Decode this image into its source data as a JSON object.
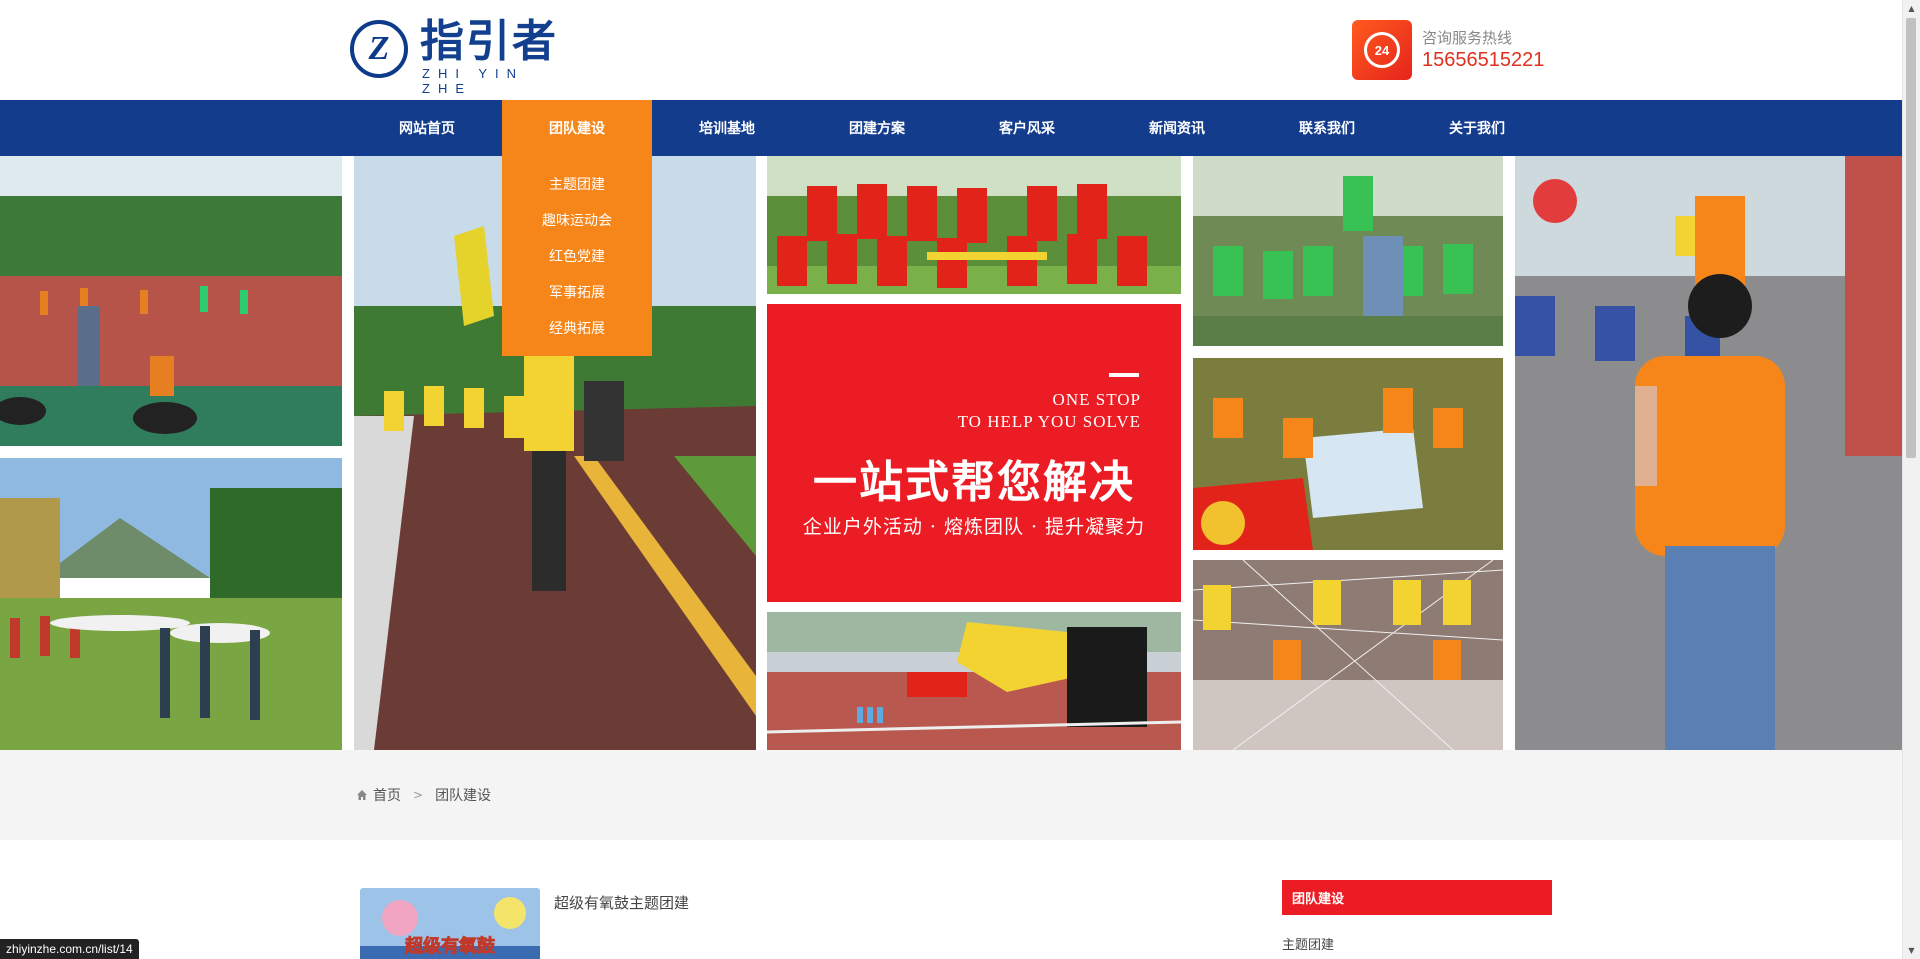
{
  "header": {
    "logo_cn": "指引者",
    "logo_en": "ZHI YIN ZHE",
    "hotline_label": "咨询服务热线",
    "hotline_number": "15656515221",
    "hotline_badge": "24"
  },
  "nav": {
    "items": [
      {
        "label": "网站首页"
      },
      {
        "label": "团队建设"
      },
      {
        "label": "培训基地"
      },
      {
        "label": "团建方案"
      },
      {
        "label": "客户风采"
      },
      {
        "label": "新闻资讯"
      },
      {
        "label": "联系我们"
      },
      {
        "label": "关于我们"
      }
    ],
    "active_index": 1,
    "dropdown": [
      "主题团建",
      "趣味运动会",
      "红色党建",
      "军事拓展",
      "经典拓展"
    ]
  },
  "banner": {
    "promo_en_1": "ONE STOP",
    "promo_en_2": "TO HELP YOU SOLVE",
    "promo_cn": "一站式帮您解决",
    "promo_sub": "企业户外活动 · 熔炼团队 · 提升凝聚力",
    "slides": [
      "1",
      "2",
      "3",
      "4"
    ],
    "active_slide": 3
  },
  "breadcrumb": {
    "home": "首页",
    "current": "团队建设"
  },
  "content": {
    "article_title": "超级有氧鼓主题团建",
    "thumb_caption": "超级有氧鼓"
  },
  "sidebar": {
    "heading": "团队建设",
    "first_item": "主题团建"
  },
  "status_url": "zhiyinzhe.com.cn/list/14",
  "colors": {
    "nav_blue": "#133c8c",
    "accent_orange": "#f7861a",
    "brand_red": "#ec1c24"
  }
}
